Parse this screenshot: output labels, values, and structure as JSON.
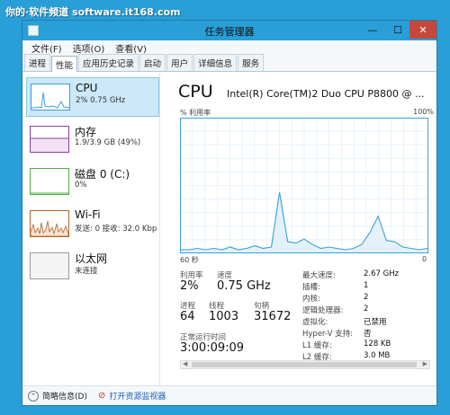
{
  "watermark": "你的·软件频道 software.it168.com",
  "window": {
    "title": "任务管理器",
    "controls": {
      "minimize": "—",
      "maximize": "☐",
      "close": "✕"
    }
  },
  "menu": [
    "文件(F)",
    "选项(O)",
    "查看(V)"
  ],
  "tabs": [
    "进程",
    "性能",
    "应用历史记录",
    "启动",
    "用户",
    "详细信息",
    "服务"
  ],
  "active_tab": "性能",
  "sidebar": {
    "items": [
      {
        "title": "CPU",
        "sub": "2% 0.75 GHz",
        "color": "#3c9fd8"
      },
      {
        "title": "内存",
        "sub": "1.9/3.9 GB (49%)",
        "color": "#8b3fa4"
      },
      {
        "title": "磁盘 0 (C:)",
        "sub": "0%",
        "color": "#4caf3a"
      },
      {
        "title": "Wi-Fi",
        "sub": "发送: 0 接收: 32.0 Kbp",
        "color": "#b3622b"
      },
      {
        "title": "以太网",
        "sub": "未连接",
        "color": "#999999"
      }
    ]
  },
  "cpu": {
    "title": "CPU",
    "model": "Intel(R) Core(TM)2 Duo CPU P8800 @ ...",
    "graph_label_left": "% 利用率",
    "graph_label_right": "100%",
    "axis_left": "60 秒",
    "axis_right": "0",
    "accent": "#3c9fd8",
    "chart_data": {
      "type": "line",
      "title": "",
      "xlabel": "",
      "ylabel": "% 利用率",
      "ylim": [
        0,
        100
      ],
      "x": [
        60,
        58,
        56,
        54,
        52,
        50,
        48,
        46,
        44,
        42,
        40,
        38,
        36,
        34,
        32,
        30,
        28,
        26,
        24,
        22,
        20,
        18,
        16,
        14,
        12,
        10,
        8,
        6,
        4,
        2,
        0
      ],
      "series": [
        {
          "name": "",
          "values": [
            2,
            2,
            3,
            2,
            3,
            2,
            4,
            2,
            3,
            5,
            3,
            4,
            45,
            8,
            7,
            10,
            6,
            3,
            4,
            3,
            2,
            3,
            6,
            15,
            27,
            9,
            8,
            4,
            3,
            2,
            3
          ]
        }
      ]
    }
  },
  "stats": {
    "util_label": "利用率",
    "util_value": "2%",
    "speed_label": "速度",
    "speed_value": "0.75 GHz",
    "proc_label": "进程",
    "proc_value": "64",
    "thread_label": "线程",
    "thread_value": "1003",
    "handle_label": "句柄",
    "handle_value": "31672",
    "uptime_label": "正常运行时间",
    "uptime_value": "3:00:09:09"
  },
  "specs": [
    {
      "k": "最大速度:",
      "v": "2.67 GHz"
    },
    {
      "k": "插槽:",
      "v": "1"
    },
    {
      "k": "内核:",
      "v": "2"
    },
    {
      "k": "逻辑处理器:",
      "v": "2"
    },
    {
      "k": "虚拟化:",
      "v": "已禁用"
    },
    {
      "k": "Hyper-V 支持:",
      "v": "否"
    },
    {
      "k": "L1 缓存:",
      "v": "128 KB"
    },
    {
      "k": "L2 缓存:",
      "v": "3.0 MB"
    }
  ],
  "footer": {
    "less": "简略信息(D)",
    "monitor": "打开资源监视器"
  }
}
